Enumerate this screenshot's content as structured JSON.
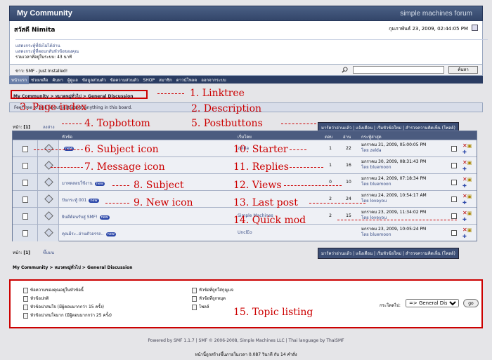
{
  "header": {
    "title": "My Community",
    "logo": "simple machines forum"
  },
  "user": {
    "hello": "สวัสดี Nimita",
    "date": "กุมภาพันธ์ 23, 2009, 02:44:05 PM",
    "links": [
      "แสดงกระทู้ที่ยังไม่ได้อ่าน",
      "แสดงกระทู้ที่ตอบกลับหัวข้อของคุณ",
      "รวมเวลาที่อยู่ในระบบ: 43 นาที"
    ]
  },
  "news": {
    "text": "ข่าว: SMF - Just Installed!",
    "search_btn": "ค้นหา"
  },
  "nav": [
    "หน้าแรก",
    "ช่วยเหลือ",
    "ค้นหา",
    "ผู้ดูแล",
    "ข้อมูลส่วนตัว",
    "ข้อความส่วนตัว",
    "SHOP",
    "สมาชิก",
    "ดาวน์โหลด",
    "ออกจากระบบ"
  ],
  "linktree": "My Community > หมวดหมู่ทั่วไป > General Discussion",
  "description": "Feel free to talk about just about anything in this board.",
  "pages": {
    "label": "หน้า:",
    "current": "[1]",
    "bottom": "ลงล่าง",
    "top": "ขึ้นบน"
  },
  "postbuttons": [
    "มาร์คว่าอ่านแล้ว",
    "แจ้งเตือน",
    "เริ่มหัวข้อใหม่",
    "สำรวจความคิดเห็น (โพลล์)"
  ],
  "table": {
    "headers": {
      "subject": "หัวข้อ",
      "starter": "เริ่มโดย",
      "replies": "ตอบ",
      "views": "อ่าน",
      "last": "กระทู้ล่าสุด"
    },
    "rows": [
      {
        "subject": "",
        "starter": "zelda",
        "replies": "1",
        "views": "22",
        "last_date": "มกราคม 31, 2009, 05:00:05 PM",
        "last_by": "โดย zelda",
        "new": "new"
      },
      {
        "subject": "",
        "starter": "",
        "replies": "1",
        "views": "16",
        "last_date": "มกราคม 30, 2009, 08:31:43 PM",
        "last_by": "โดย bluemoon",
        "new": ""
      },
      {
        "subject": "มาทดสอบใช้งาน",
        "starter": "",
        "replies": "0",
        "views": "10",
        "last_date": "มกราคม 24, 2009, 07:18:34 PM",
        "last_by": "โดย bluemoon",
        "new": "new"
      },
      {
        "subject": "ปันกระทู้ 001",
        "starter": "",
        "replies": "2",
        "views": "24",
        "last_date": "มกราคม 24, 2009, 10:54:17 AM",
        "last_by": "โดย loveyou",
        "new": "new"
      },
      {
        "subject": "ยินดีต้อนรับสู่ SMF!",
        "starter": "Simple Machines",
        "replies": "2",
        "views": "15",
        "last_date": "มกราคม 23, 2009, 11:34:02 PM",
        "last_by": "โดย loveyou",
        "new": "new"
      },
      {
        "subject": "คุณมีระ..อ่านตัวอรรถ..",
        "starter": "UnclEo",
        "replies": "",
        "views": "",
        "last_date": "มกราคม 23, 2009, 10:05:24 PM",
        "last_by": "โดย bluemoon",
        "new": "new"
      }
    ]
  },
  "legend": {
    "left": [
      "ข้อความของคุณอยู่ในหัวข้อนี้",
      "หัวข้อปกติ",
      "หัวข้อน่าสนใจ (มีผู้ตอบมากกว่า 15 ครั้ง)",
      "หัวข้อน่าสนใจมาก (มีผู้ตอบมากกว่า 25 ครั้ง)"
    ],
    "right": [
      "หัวข้อที่ถูกใส่กุญแจ",
      "หัวข้อที่ถูกหมุด",
      "โพลล์"
    ],
    "jump_label": "กระโดดไป:",
    "jump_value": "=> General Discussion",
    "go": "go"
  },
  "footer": {
    "line1": "Powered by SMF 1.1.7 | SMF © 2006-2008, Simple Machines LLC | Thai language by ThaiSMF",
    "line2": "หน้านี้ถูกสร้างขึ้นภายในเวลา 0.087 วินาที กับ 14 คำสั่ง"
  },
  "annotations": [
    "1. Linktree",
    "2. Description",
    "3. Page index",
    "4. Topbottom",
    "5. Postbuttons",
    "6. Subject icon",
    "7. Message icon",
    "8. Subject",
    "9. New icon",
    "10. Starter",
    "11. Replies",
    "12. Views",
    "13. Last post",
    "14. Quick mod",
    "15. Topic listing"
  ]
}
